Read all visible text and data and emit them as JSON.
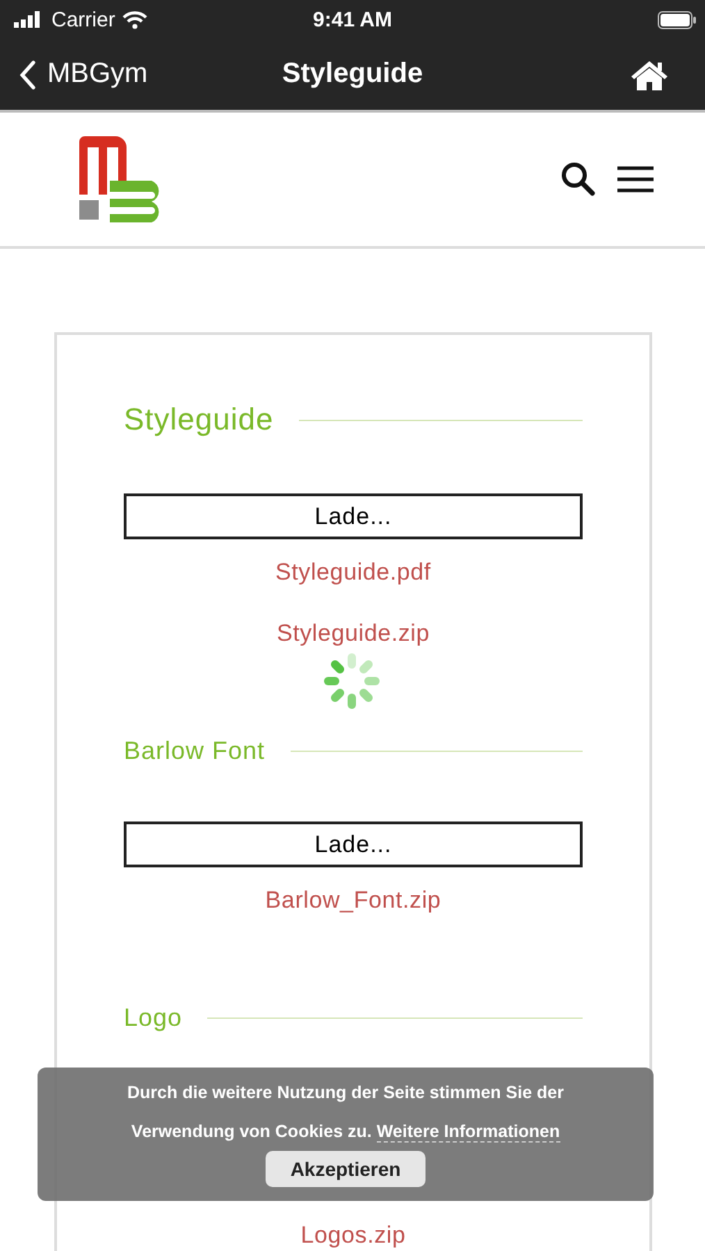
{
  "status_bar": {
    "carrier": "Carrier",
    "time": "9:41 AM"
  },
  "nav_bar": {
    "back_label": "MBGym",
    "title": "Styleguide"
  },
  "sections": [
    {
      "title": "Styleguide",
      "loading_button": "Lade...",
      "links": [
        "Styleguide.pdf",
        "Styleguide.zip"
      ]
    },
    {
      "title": "Barlow Font",
      "loading_button": "Lade...",
      "links": [
        "Barlow_Font.zip"
      ]
    },
    {
      "title": "Logo",
      "links": [
        "Logos.zip"
      ]
    }
  ],
  "loading_spinner": true,
  "cookie_banner": {
    "text": "Durch die weitere Nutzung der Seite stimmen Sie der Verwendung von Cookies zu.",
    "link": "Weitere Informationen",
    "button": "Akzeptieren"
  }
}
